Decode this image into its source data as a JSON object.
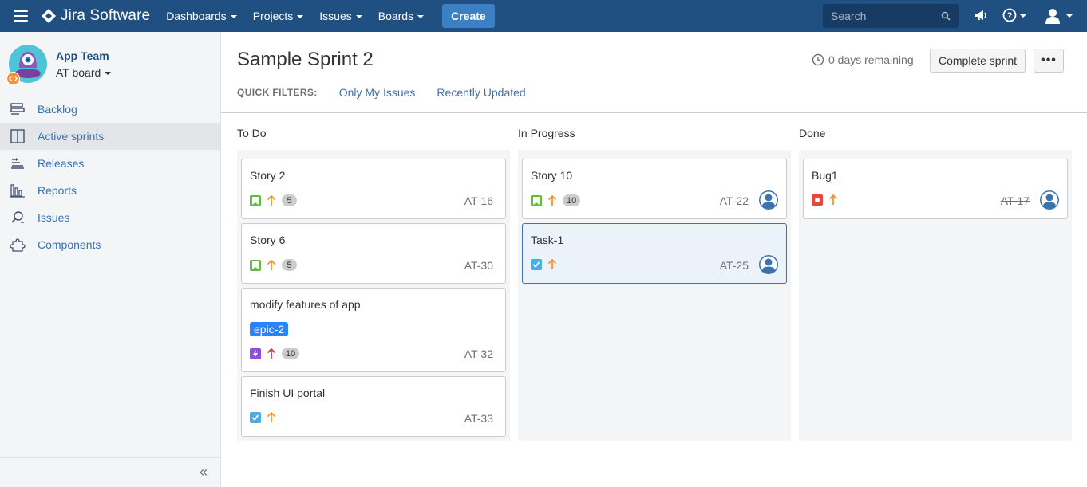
{
  "topnav": {
    "brand": "Jira Software",
    "menu": [
      "Dashboards",
      "Projects",
      "Issues",
      "Boards"
    ],
    "create_label": "Create",
    "search_placeholder": "Search"
  },
  "sidebar": {
    "project_name": "App Team",
    "board_name": "AT board",
    "items": [
      {
        "label": "Backlog",
        "icon": "backlog-icon"
      },
      {
        "label": "Active sprints",
        "icon": "active-sprints-icon"
      },
      {
        "label": "Releases",
        "icon": "releases-icon"
      },
      {
        "label": "Reports",
        "icon": "reports-icon"
      },
      {
        "label": "Issues",
        "icon": "issues-icon"
      },
      {
        "label": "Components",
        "icon": "components-icon"
      }
    ],
    "active_index": 1,
    "collapse_glyph": "«"
  },
  "sprint": {
    "title": "Sample Sprint 2",
    "remaining": "0 days remaining",
    "complete_label": "Complete sprint",
    "more_label": "•••"
  },
  "filters": {
    "label": "QUICK FILTERS:",
    "items": [
      "Only My Issues",
      "Recently Updated"
    ]
  },
  "columns": [
    {
      "name": "To Do",
      "cards": [
        {
          "title": "Story 2",
          "type": "story",
          "priority": "high",
          "points": "5",
          "key": "AT-16"
        },
        {
          "title": "Story 6",
          "type": "story",
          "priority": "high",
          "points": "5",
          "key": "AT-30"
        },
        {
          "title": "modify features of app",
          "epic": "epic-2",
          "type": "epic",
          "priority": "highest",
          "points": "10",
          "key": "AT-32"
        },
        {
          "title": "Finish UI portal",
          "type": "task",
          "priority": "high",
          "key": "AT-33"
        }
      ]
    },
    {
      "name": "In Progress",
      "cards": [
        {
          "title": "Story 10",
          "type": "story",
          "priority": "high",
          "points": "10",
          "key": "AT-22",
          "assignee": true
        },
        {
          "title": "Task-1",
          "type": "task",
          "priority": "high",
          "key": "AT-25",
          "assignee": true,
          "selected": true
        }
      ]
    },
    {
      "name": "Done",
      "cards": [
        {
          "title": "Bug1",
          "type": "bug",
          "priority": "high",
          "key": "AT-17",
          "assignee": true,
          "done": true
        }
      ]
    }
  ],
  "colors": {
    "nav_bg": "#205081",
    "link": "#3b73af",
    "story": "#63ba3c",
    "task": "#4bade8",
    "bug": "#e5493a",
    "epic": "#904ee2",
    "priority_high": "#f79232",
    "priority_highest": "#d04437",
    "epic_label": "#2684ff"
  }
}
